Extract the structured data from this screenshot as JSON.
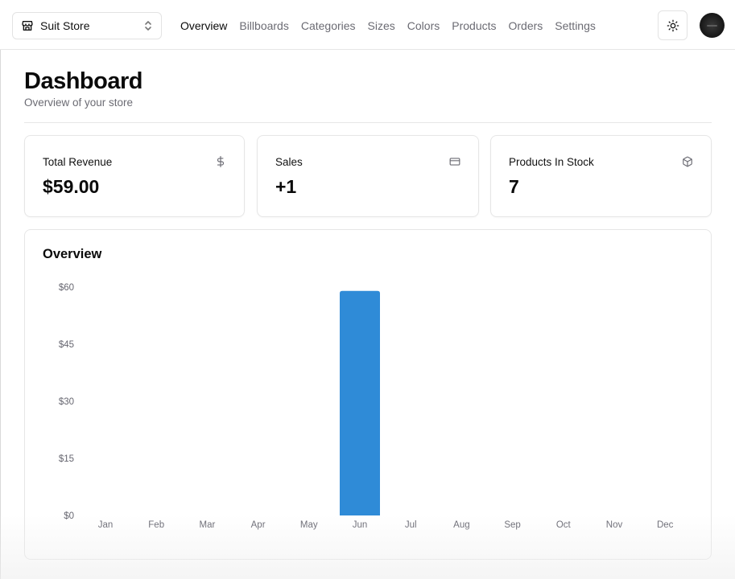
{
  "store_switcher": {
    "name": "Suit Store",
    "icon": "store-icon"
  },
  "nav": {
    "items": [
      {
        "label": "Overview",
        "active": true
      },
      {
        "label": "Billboards",
        "active": false
      },
      {
        "label": "Categories",
        "active": false
      },
      {
        "label": "Sizes",
        "active": false
      },
      {
        "label": "Colors",
        "active": false
      },
      {
        "label": "Products",
        "active": false
      },
      {
        "label": "Orders",
        "active": false
      },
      {
        "label": "Settings",
        "active": false
      }
    ]
  },
  "header": {
    "theme_toggle_icon": "sun-icon",
    "avatar_icon": "user-avatar"
  },
  "page": {
    "title": "Dashboard",
    "subtitle": "Overview of your store"
  },
  "stats": [
    {
      "label": "Total Revenue",
      "value": "$59.00",
      "icon": "dollar-icon"
    },
    {
      "label": "Sales",
      "value": "+1",
      "icon": "credit-card-icon"
    },
    {
      "label": "Products In Stock",
      "value": "7",
      "icon": "package-icon"
    }
  ],
  "overview": {
    "title": "Overview"
  },
  "colors": {
    "bar": "#2f8bd7",
    "muted_text": "#6b6b73",
    "border": "#e6e6e6"
  },
  "chart_data": {
    "type": "bar",
    "categories": [
      "Jan",
      "Feb",
      "Mar",
      "Apr",
      "May",
      "Jun",
      "Jul",
      "Aug",
      "Sep",
      "Oct",
      "Nov",
      "Dec"
    ],
    "values": [
      0,
      0,
      0,
      0,
      0,
      59,
      0,
      0,
      0,
      0,
      0,
      0
    ],
    "yticks": [
      0,
      15,
      30,
      45,
      60
    ],
    "ytick_labels": [
      "$0",
      "$15",
      "$30",
      "$45",
      "$60"
    ],
    "ylim": [
      0,
      60
    ],
    "grid": false,
    "legend": "none",
    "title": "",
    "xlabel": "",
    "ylabel": ""
  }
}
